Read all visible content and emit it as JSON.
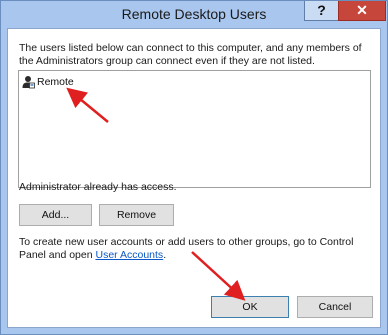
{
  "window": {
    "title": "Remote Desktop Users",
    "help_label": "?",
    "close_label": "✕"
  },
  "dialog": {
    "intro_text": "The users listed below can connect to this computer, and any members of the Administrators group can connect even if they are not listed.",
    "users": [
      {
        "name": "Remote",
        "icon": "user-icon"
      }
    ],
    "admin_text": "Administrator already has access.",
    "add_label": "Add...",
    "remove_label": "Remove",
    "footer_text": "To create new user accounts or add users to other groups, go to Control Panel and open ",
    "footer_link": "User Accounts",
    "footer_end": ".",
    "ok_label": "OK",
    "cancel_label": "Cancel"
  },
  "colors": {
    "title_bar": "#a9c7ee",
    "close_button": "#c7463b",
    "link": "#0b58c6",
    "annotation_arrow": "#e02020"
  }
}
